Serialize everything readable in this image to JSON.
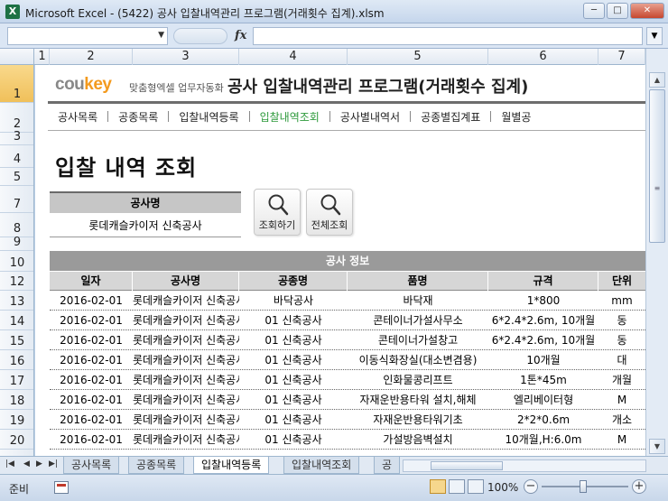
{
  "window": {
    "title": "Microsoft Excel - (5422) 공사 입찰내역관리 프로그램(거래횟수 집계).xlsm",
    "app_icon": "X",
    "controls": [
      "─",
      "□",
      "✕"
    ]
  },
  "formula_bar": {
    "fx": "fx",
    "name_box": "",
    "formula": ""
  },
  "columns": [
    "1",
    "2",
    "3",
    "4",
    "5",
    "6",
    "7"
  ],
  "rows": [
    "1",
    "2",
    "3",
    "4",
    "5",
    "7",
    "8",
    "9",
    "10",
    "12",
    "13",
    "14",
    "15",
    "16",
    "17",
    "18",
    "19",
    "20"
  ],
  "header": {
    "logo_prefix": "cou",
    "logo_accent": "key",
    "logo_sub": "맞춤형엑셀 업무자동화",
    "title": "공사 입찰내역관리 프로그램(거래횟수 집계)"
  },
  "nav": {
    "items": [
      "공사목록",
      "공종목록",
      "입찰내역등록",
      "입찰내역조회",
      "공사별내역서",
      "공종별집계표",
      "월별공"
    ],
    "active_index": 3
  },
  "page_title": "입찰 내역 조회",
  "search": {
    "label": "공사명",
    "value": "롯데캐슬카이저 신축공사",
    "search_button": "조회하기",
    "all_button": "전체조회"
  },
  "table": {
    "band": "공사 정보",
    "headers": [
      "일자",
      "공사명",
      "공종명",
      "품명",
      "규격",
      "단위"
    ],
    "rows": [
      [
        "2016-02-01",
        "롯데캐슬카이저 신축공사",
        "바닥공사",
        "바닥재",
        "1*800",
        "mm"
      ],
      [
        "2016-02-01",
        "롯데캐슬카이저 신축공사",
        "01 신축공사",
        "콘테이너가설사무소",
        "6*2.4*2.6m, 10개월",
        "동"
      ],
      [
        "2016-02-01",
        "롯데캐슬카이저 신축공사",
        "01 신축공사",
        "콘테이너가설창고",
        "6*2.4*2.6m, 10개월",
        "동"
      ],
      [
        "2016-02-01",
        "롯데캐슬카이저 신축공사",
        "01 신축공사",
        "이동식화장실(대소변겸용)",
        "10개월",
        "대"
      ],
      [
        "2016-02-01",
        "롯데캐슬카이저 신축공사",
        "01 신축공사",
        "인화물콩리프트",
        "1톤*45m",
        "개월"
      ],
      [
        "2016-02-01",
        "롯데캐슬카이저 신축공사",
        "01 신축공사",
        "자재운반용타워 설치,해체",
        "엘리베이터형",
        "M"
      ],
      [
        "2016-02-01",
        "롯데캐슬카이저 신축공사",
        "01 신축공사",
        "자재운반용타워기초",
        "2*2*0.6m",
        "개소"
      ],
      [
        "2016-02-01",
        "롯데캐슬카이저 신축공사",
        "01 신축공사",
        "가설방음벽설치",
        "10개월,H:6.0m",
        "M"
      ]
    ]
  },
  "sheet_tabs": [
    "공사목록",
    "공종목록",
    "입찰내역등록",
    "입찰내역조회",
    "공"
  ],
  "active_tab_index": 2,
  "status": {
    "ready": "준비",
    "zoom": "100%"
  },
  "icons": [
    "excel-icon",
    "search-icon",
    "chevron-down-icon",
    "macro-record-icon",
    "scroll-up-icon",
    "scroll-down-icon"
  ]
}
